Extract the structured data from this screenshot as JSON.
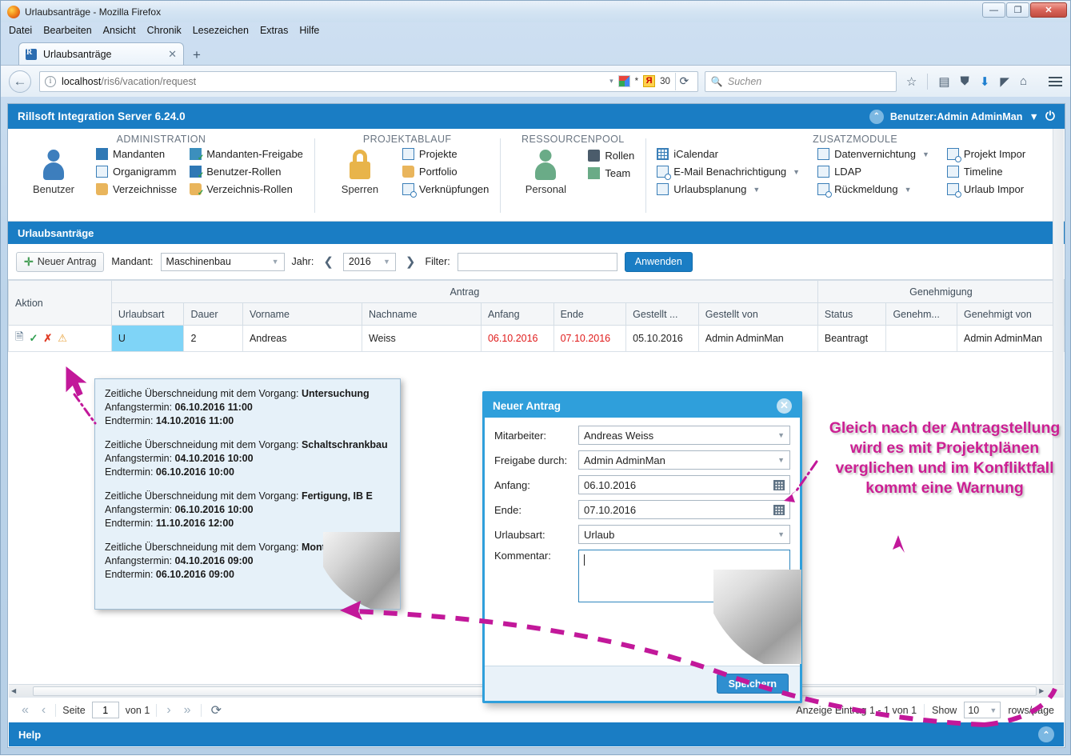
{
  "browser": {
    "window_title": "Urlaubsanträge - Mozilla Firefox",
    "menu": [
      "Datei",
      "Bearbeiten",
      "Ansicht",
      "Chronik",
      "Lesezeichen",
      "Extras",
      "Hilfe"
    ],
    "tab_label": "Urlaubsanträge",
    "tab_close": "✕",
    "new_tab": "+",
    "url_host": "localhost",
    "url_path": "/ris6/vacation/request",
    "search_placeholder": "Suchen",
    "badge_number": "30",
    "badge_star": "*",
    "badge_ya": "Я",
    "reload": "⟳",
    "min": "—",
    "max": "❐",
    "close": "✕"
  },
  "app": {
    "title": "Rillsoft Integration Server 6.24.0",
    "user_label": "Benutzer:Admin AdminMan",
    "user_caret": "▼",
    "power_icon": "⏻"
  },
  "ribbon": {
    "groups": [
      {
        "title": "ADMINISTRATION",
        "big": {
          "label": "Benutzer",
          "icon": "person-icon-blue"
        },
        "columns": [
          [
            {
              "label": "Mandanten",
              "icon": "factory-icon"
            },
            {
              "label": "Organigramm",
              "icon": "orgchart-icon"
            },
            {
              "label": "Verzeichnisse",
              "icon": "folder-icon"
            }
          ],
          [
            {
              "label": "Mandanten-Freigabe",
              "icon": "factory-check-icon"
            },
            {
              "label": "Benutzer-Rollen",
              "icon": "user-check-icon"
            },
            {
              "label": "Verzeichnis-Rollen",
              "icon": "folder-check-icon"
            }
          ]
        ]
      },
      {
        "title": "PROJEKTABLAUF",
        "big": {
          "label": "Sperren",
          "icon": "lock-icon"
        },
        "columns": [
          [
            {
              "label": "Projekte",
              "icon": "project-icon"
            },
            {
              "label": "Portfolio",
              "icon": "portfolio-icon"
            },
            {
              "label": "Verknüpfungen",
              "icon": "link-icon"
            }
          ]
        ]
      },
      {
        "title": "RESSOURCENPOOL",
        "big": {
          "label": "Personal",
          "icon": "person-icon-green"
        },
        "columns": [
          [
            {
              "label": "Rollen",
              "icon": "role-icon"
            },
            {
              "label": "Team",
              "icon": "team-icon"
            }
          ]
        ]
      },
      {
        "title": "ZUSATZMODULE",
        "big": null,
        "columns": [
          [
            {
              "label": "iCalendar",
              "icon": "calendar-icon",
              "caret": false
            },
            {
              "label": "E-Mail Benachrichtigung",
              "icon": "mail-clock-icon",
              "caret": true
            },
            {
              "label": "Urlaubsplanung",
              "icon": "vacation-icon",
              "caret": true
            }
          ],
          [
            {
              "label": "Datenvernichtung",
              "icon": "shred-icon",
              "caret": true
            },
            {
              "label": "LDAP",
              "icon": "ldap-icon",
              "caret": false
            },
            {
              "label": "Rückmeldung",
              "icon": "feedback-icon",
              "caret": true
            }
          ],
          [
            {
              "label": "Projekt Impor",
              "icon": "project-import-icon",
              "caret": false
            },
            {
              "label": "Timeline",
              "icon": "timeline-icon",
              "caret": false
            },
            {
              "label": "Urlaub Impor",
              "icon": "vacation-import-icon",
              "caret": false
            }
          ]
        ]
      }
    ]
  },
  "section": {
    "title": "Urlaubsanträge"
  },
  "toolbar": {
    "new_request": "Neuer Antrag",
    "plus": "✛",
    "mandant_label": "Mandant:",
    "mandant_value": "Maschinenbau",
    "jahr_label": "Jahr:",
    "jahr_value": "2016",
    "prev_arrow": "❮",
    "next_arrow": "❯",
    "filter_label": "Filter:",
    "filter_value": "",
    "apply": "Anwenden"
  },
  "table": {
    "group_headers": [
      "Aktion",
      "Antrag",
      "Genehmigung"
    ],
    "columns": [
      "Urlaubsart",
      "Dauer",
      "Vorname",
      "Nachname",
      "Anfang",
      "Ende",
      "Gestellt ...",
      "Gestellt von",
      "Status",
      "Genehm...",
      "Genehmigt von"
    ],
    "rows": [
      {
        "actions": [
          "edit-icon",
          "approve-icon",
          "reject-icon",
          "warning-icon"
        ],
        "urlaubsart": "U",
        "dauer": "2",
        "vorname": "Andreas",
        "nachname": "Weiss",
        "anfang": "06.10.2016",
        "ende": "07.10.2016",
        "gestellt_am": "05.10.2016",
        "gestellt_von": "Admin AdminMan",
        "status": "Beantragt",
        "genehmigt_am": "",
        "genehmigt_von": "Admin AdminMan"
      }
    ]
  },
  "tooltip": {
    "blocks": [
      {
        "lead": "Zeitliche Überschneidung mit dem Vorgang: ",
        "task": "Untersuchung",
        "start_label": "Anfangstermin: ",
        "start": "06.10.2016 11:00",
        "end_label": "Endtermin: ",
        "end": "14.10.2016 11:00"
      },
      {
        "lead": "Zeitliche Überschneidung mit dem Vorgang: ",
        "task": "Schaltschrankbau",
        "start_label": "Anfangstermin: ",
        "start": "04.10.2016 10:00",
        "end_label": "Endtermin: ",
        "end": "06.10.2016 10:00"
      },
      {
        "lead": "Zeitliche Überschneidung mit dem Vorgang: ",
        "task": "Fertigung, IB E",
        "start_label": "Anfangstermin: ",
        "start": "06.10.2016 10:00",
        "end_label": "Endtermin: ",
        "end": "11.10.2016 12:00"
      },
      {
        "lead": "Zeitliche Überschneidung mit dem Vorgang: ",
        "task": "Mont",
        "start_label": "Anfangstermin: ",
        "start": "04.10.2016 09:00",
        "end_label": "Endtermin: ",
        "end": "06.10.2016 09:00"
      }
    ]
  },
  "dialog": {
    "title": "Neuer Antrag",
    "close": "✕",
    "fields": [
      {
        "label": "Mitarbeiter:",
        "value": "Andreas Weiss",
        "type": "select"
      },
      {
        "label": "Freigabe durch:",
        "value": "Admin AdminMan",
        "type": "select"
      },
      {
        "label": "Anfang:",
        "value": "06.10.2016",
        "type": "date"
      },
      {
        "label": "Ende:",
        "value": "07.10.2016",
        "type": "date"
      },
      {
        "label": "Urlaubsart:",
        "value": "Urlaub",
        "type": "select"
      },
      {
        "label": "Kommentar:",
        "value": "",
        "type": "textarea"
      }
    ],
    "save": "Speichern"
  },
  "annotation": {
    "text": "Gleich nach der Antragstellung wird es mit Projektplänen verglichen und im Konfliktfall kommt eine Warnung",
    "color": "#cc1f93"
  },
  "pagination": {
    "first": "«",
    "prev": "‹",
    "page_label": "Seite",
    "page_value": "1",
    "of_label": "von 1",
    "next": "›",
    "last": "»",
    "refresh": "⟳",
    "display_info": "Anzeige Eintrag 1 - 1 von 1",
    "show_label": "Show",
    "rows_value": "10",
    "rows_suffix": "rows/page"
  },
  "help": {
    "label": "Help",
    "scroll_top": "⌃"
  }
}
